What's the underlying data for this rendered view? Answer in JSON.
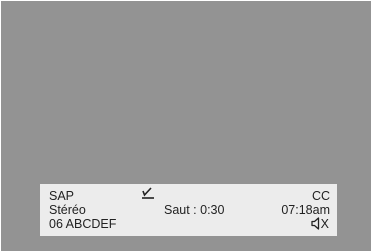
{
  "banner": {
    "audio_mode": "SAP",
    "sound": "Stéréo",
    "channel": "06 ABCDEF",
    "skip": "Saut : 0:30",
    "caption": "CC",
    "time": "07:18am",
    "mute_mark": "X",
    "icons": {
      "check": "checkmark-icon",
      "speaker": "speaker-muted-icon"
    }
  },
  "colors": {
    "screen_background": "#939393",
    "banner_background": "#ececec",
    "text": "#222222"
  }
}
